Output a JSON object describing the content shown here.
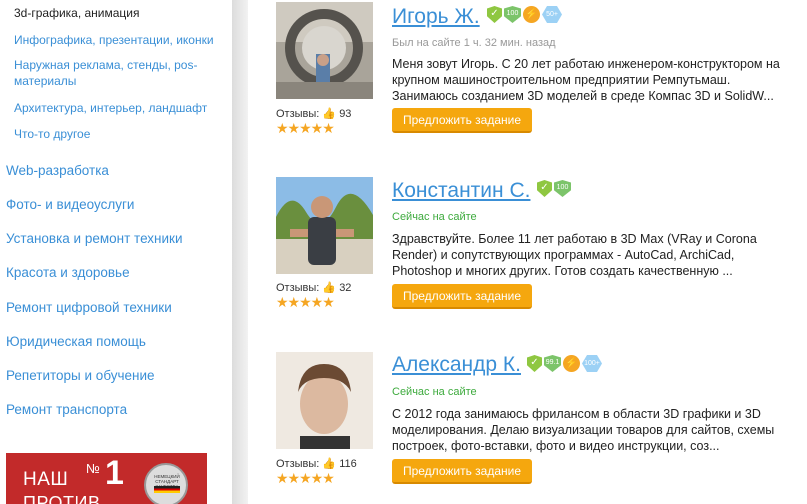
{
  "sidebar": {
    "active_sub": "3d-графика, анимация",
    "subs": [
      "Инфографика, презентации, иконки",
      "Наружная реклама, стенды, pos-материалы",
      "Архитектура, интерьер, ландшафт",
      "Что-то другое"
    ],
    "categories": [
      "Web-разработка",
      "Фото- и видеоуслуги",
      "Установка и ремонт техники",
      "Красота и здоровье",
      "Ремонт цифровой техники",
      "Юридическая помощь",
      "Репетиторы и обучение",
      "Ремонт транспорта"
    ],
    "promo": {
      "line1": "НАШ",
      "no": "№",
      "one": "1",
      "line2": "ПРОТИВ",
      "badge_text": "НЕМЕЦКИЙ СТАНДАРТ КАЧЕСТВА"
    }
  },
  "reviews_label": "Отзывы:",
  "offer_label": "Предложить задание",
  "stars": "★★★★★",
  "freelancers": [
    {
      "name": "Игорь Ж.",
      "status": "Был на сайте 1 ч. 32 мин. назад",
      "reviews": "93",
      "badges": [
        "✓",
        "100",
        "⚡",
        "50+"
      ],
      "description": "Меня зовут Игорь. С 20 лет работаю инженером-конструктором на крупном машиностроительном предприятии Ремпутьмаш. Занимаюсь созданием 3D моделей в среде Компас 3D и SolidW..."
    },
    {
      "name": "Константин С.",
      "status": "Сейчас на сайте",
      "reviews": "32",
      "badges": [
        "✓",
        "100"
      ],
      "description": "Здравствуйте. Более 11 лет работаю в 3D Max (VRay и Corona Render) и сопутствующих программах - AutoCad, ArchiCad, Photoshop и многих других. Готов создать качественную ..."
    },
    {
      "name": "Александр К.",
      "status": "Сейчас на сайте",
      "reviews": "116",
      "badges": [
        "✓",
        "99.1",
        "⚡",
        "100+"
      ],
      "description": "С 2012 года занимаюсь фрилансом в области 3D графики и 3D моделирования. Делаю визуализации товаров для сайтов, схемы построек, фото-вставки, фото и видео инструкции, соз..."
    }
  ]
}
